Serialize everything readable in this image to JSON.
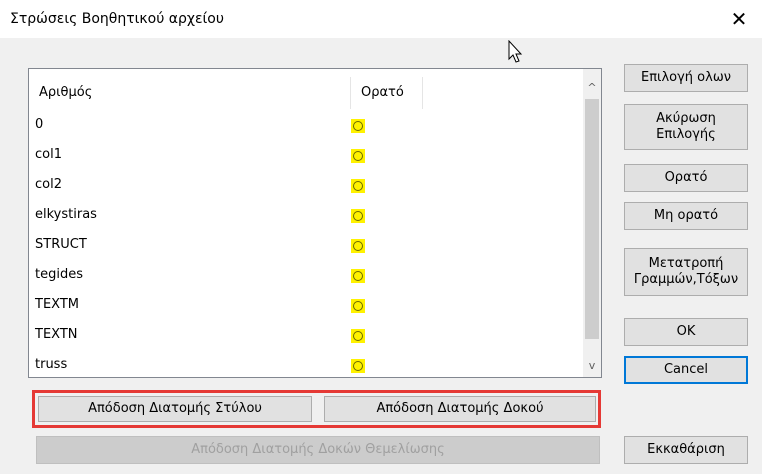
{
  "window": {
    "title": "Στρώσεις Βοηθητικού αρχείου",
    "close_label": "✕"
  },
  "list": {
    "columns": [
      "Αριθμός",
      "Ορατό"
    ],
    "rows": [
      "0",
      "col1",
      "col2",
      "elkystiras",
      "STRUCT",
      "tegides",
      "TEXTM",
      "TEXTN",
      "truss"
    ],
    "scroll_up": "^",
    "scroll_down": "v"
  },
  "side_buttons": {
    "select_all": "Επιλογή ολων",
    "cancel_selection": "Ακύρωση\nΕπιλογής",
    "visible": "Ορατό",
    "not_visible": "Μη ορατό",
    "convert": "Μετατροπή\nΓραμμών,Τόξων",
    "ok": "OK",
    "cancel": "Cancel",
    "clear": "Εκκαθάριση"
  },
  "bottom_buttons": {
    "assign_column": "Απόδοση Διατομής Στύλου",
    "assign_beam": "Απόδοση Διατομής Δοκού",
    "assign_foundation": "Απόδοση Διατομής Δοκών Θεμελίωσης"
  },
  "colors": {
    "highlight": "#e53935",
    "bulb": "#fff200",
    "accent": "#0078d7"
  }
}
